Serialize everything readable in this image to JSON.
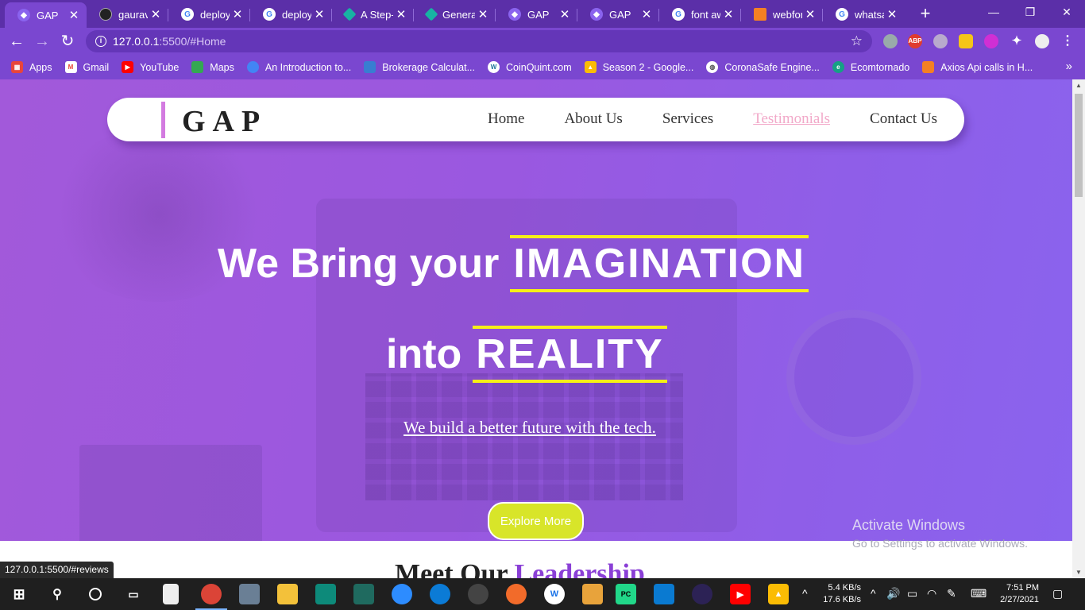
{
  "browser": {
    "tabs": [
      {
        "title": "GAP",
        "icon": "gap-favicon",
        "color": "#8a63ee"
      },
      {
        "title": "gaurav",
        "icon": "github-icon",
        "color": "#222222"
      },
      {
        "title": "deploy",
        "icon": "google-icon",
        "color": "#ffffff"
      },
      {
        "title": "deploy",
        "icon": "google-icon",
        "color": "#ffffff"
      },
      {
        "title": "A Step-",
        "icon": "diamond-icon",
        "color": "#17b3a3"
      },
      {
        "title": "Genera",
        "icon": "diamond-icon",
        "color": "#17b3a3"
      },
      {
        "title": "GAP",
        "icon": "gap-favicon",
        "color": "#8a63ee"
      },
      {
        "title": "GAP",
        "icon": "gap-favicon",
        "color": "#8a63ee"
      },
      {
        "title": "font aw",
        "icon": "google-icon",
        "color": "#ffffff"
      },
      {
        "title": "webfon",
        "icon": "stackoverflow-icon",
        "color": "#f48024"
      },
      {
        "title": "whatsa",
        "icon": "google-icon",
        "color": "#ffffff"
      }
    ],
    "new_tab": "+",
    "url_host": "127.0.0.1",
    "url_rest": ":5500/#Home",
    "bookmarks": [
      {
        "label": "Apps",
        "icon": "apps-grid-icon",
        "color": "#e8453c"
      },
      {
        "label": "Gmail",
        "icon": "gmail-icon",
        "color": "#ea4335"
      },
      {
        "label": "YouTube",
        "icon": "youtube-icon",
        "color": "#ff0000"
      },
      {
        "label": "Maps",
        "icon": "maps-icon",
        "color": "#34a853"
      },
      {
        "label": "An Introduction to...",
        "icon": "loading-icon",
        "color": "#4285f4"
      },
      {
        "label": "Brokerage Calculat...",
        "icon": "zerodha-icon",
        "color": "#387ed1"
      },
      {
        "label": "CoinQuint.com",
        "icon": "wordpress-icon",
        "color": "#21759b"
      },
      {
        "label": "Season 2 - Google...",
        "icon": "drive-icon",
        "color": "#fbbc04"
      },
      {
        "label": "CoronaSafe Engine...",
        "icon": "globe-icon",
        "color": "#555555"
      },
      {
        "label": "Ecomtornado",
        "icon": "ecom-icon",
        "color": "#16a085"
      },
      {
        "label": "Axios Api calls in H...",
        "icon": "stackoverflow-icon",
        "color": "#f48024"
      }
    ]
  },
  "site": {
    "logo": "GAP",
    "nav": [
      "Home",
      "About Us",
      "Services",
      "Testimonials",
      "Contact Us"
    ],
    "hero": {
      "line1_text": "We Bring your",
      "line1_highlight": "IMAGINATION",
      "line2_text": "into",
      "line2_highlight": "REALITY",
      "tagline": "We build a better future with the tech.",
      "cta": "Explore More"
    },
    "section_heading_start": "Meet Our",
    "section_heading_accent": "Leadership"
  },
  "overlay": {
    "activate_title": "Activate Windows",
    "activate_sub": "Go to Settings to activate Windows.",
    "status_url": "127.0.0.1:5500/#reviews"
  },
  "taskbar": {
    "net_up": "5.4 KB/s",
    "net_down": "17.6 KB/s",
    "time": "7:51 PM",
    "date": "2/27/2021"
  },
  "colors": {
    "accent_yellow": "#f6ef17",
    "hero_purple": "#9a58e0",
    "nav_hover_pink": "#f2a9c9",
    "cta_yellow": "#d8e529"
  }
}
